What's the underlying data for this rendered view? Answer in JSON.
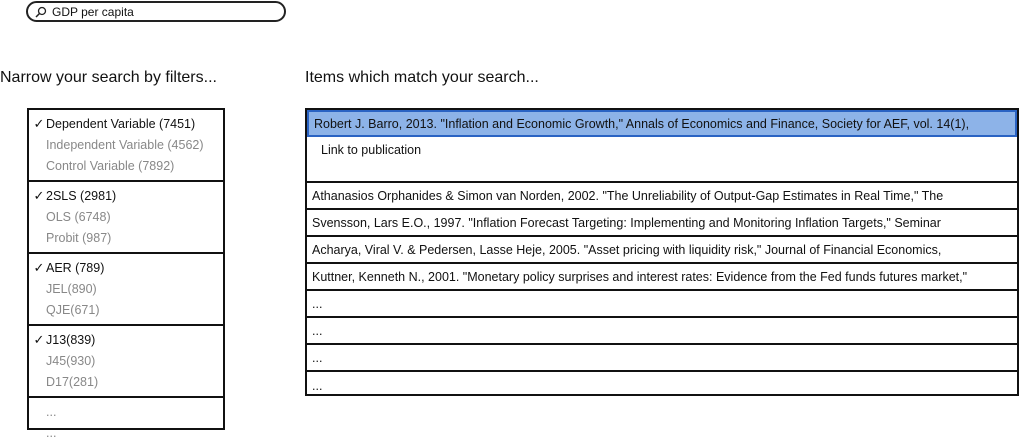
{
  "search": {
    "value": "GDP per capita"
  },
  "headings": {
    "filters": "Narrow your search by filters...",
    "results": "Items which match your search..."
  },
  "filter_groups": [
    {
      "items": [
        {
          "label": "Dependent Variable (7451)",
          "checked": true
        },
        {
          "label": "Independent Variable (4562)",
          "checked": false
        },
        {
          "label": "Control Variable (7892)",
          "checked": false
        }
      ]
    },
    {
      "items": [
        {
          "label": "2SLS (2981)",
          "checked": true
        },
        {
          "label": "OLS (6748)",
          "checked": false
        },
        {
          "label": "Probit (987)",
          "checked": false
        }
      ]
    },
    {
      "items": [
        {
          "label": "AER (789)",
          "checked": true
        },
        {
          "label": "JEL(890)",
          "checked": false
        },
        {
          "label": "QJE(671)",
          "checked": false
        }
      ]
    },
    {
      "items": [
        {
          "label": "J13(839)",
          "checked": true
        },
        {
          "label": "J45(930)",
          "checked": false
        },
        {
          "label": "D17(281)",
          "checked": false
        }
      ]
    },
    {
      "items": [
        {
          "label": "...",
          "checked": false
        },
        {
          "label": "...",
          "checked": false
        }
      ]
    }
  ],
  "check_glyph": "✓",
  "results": {
    "selected": "Robert J. Barro, 2013. \"Inflation and Economic Growth,\" Annals of Economics and Finance, Society for AEF, vol. 14(1),",
    "detail_link": "Link to publication",
    "rows": [
      "Athanasios Orphanides & Simon van Norden, 2002. \"The Unreliability of Output-Gap Estimates in Real Time,\" The",
      "Svensson, Lars E.O., 1997. \"Inflation Forecast Targeting: Implementing and Monitoring Inflation Targets,\" Seminar",
      "Acharya, Viral V. & Pedersen, Lasse Heje, 2005. \"Asset pricing with liquidity risk,\" Journal of Financial Economics,",
      "Kuttner, Kenneth N., 2001. \"Monetary policy surprises and interest rates: Evidence from the Fed funds futures market,\"",
      "...",
      "...",
      "...",
      "..."
    ]
  },
  "colors": {
    "selected_row_bg": "#8db3e8",
    "selected_row_border": "#2a63c3",
    "muted_text": "#888888"
  }
}
